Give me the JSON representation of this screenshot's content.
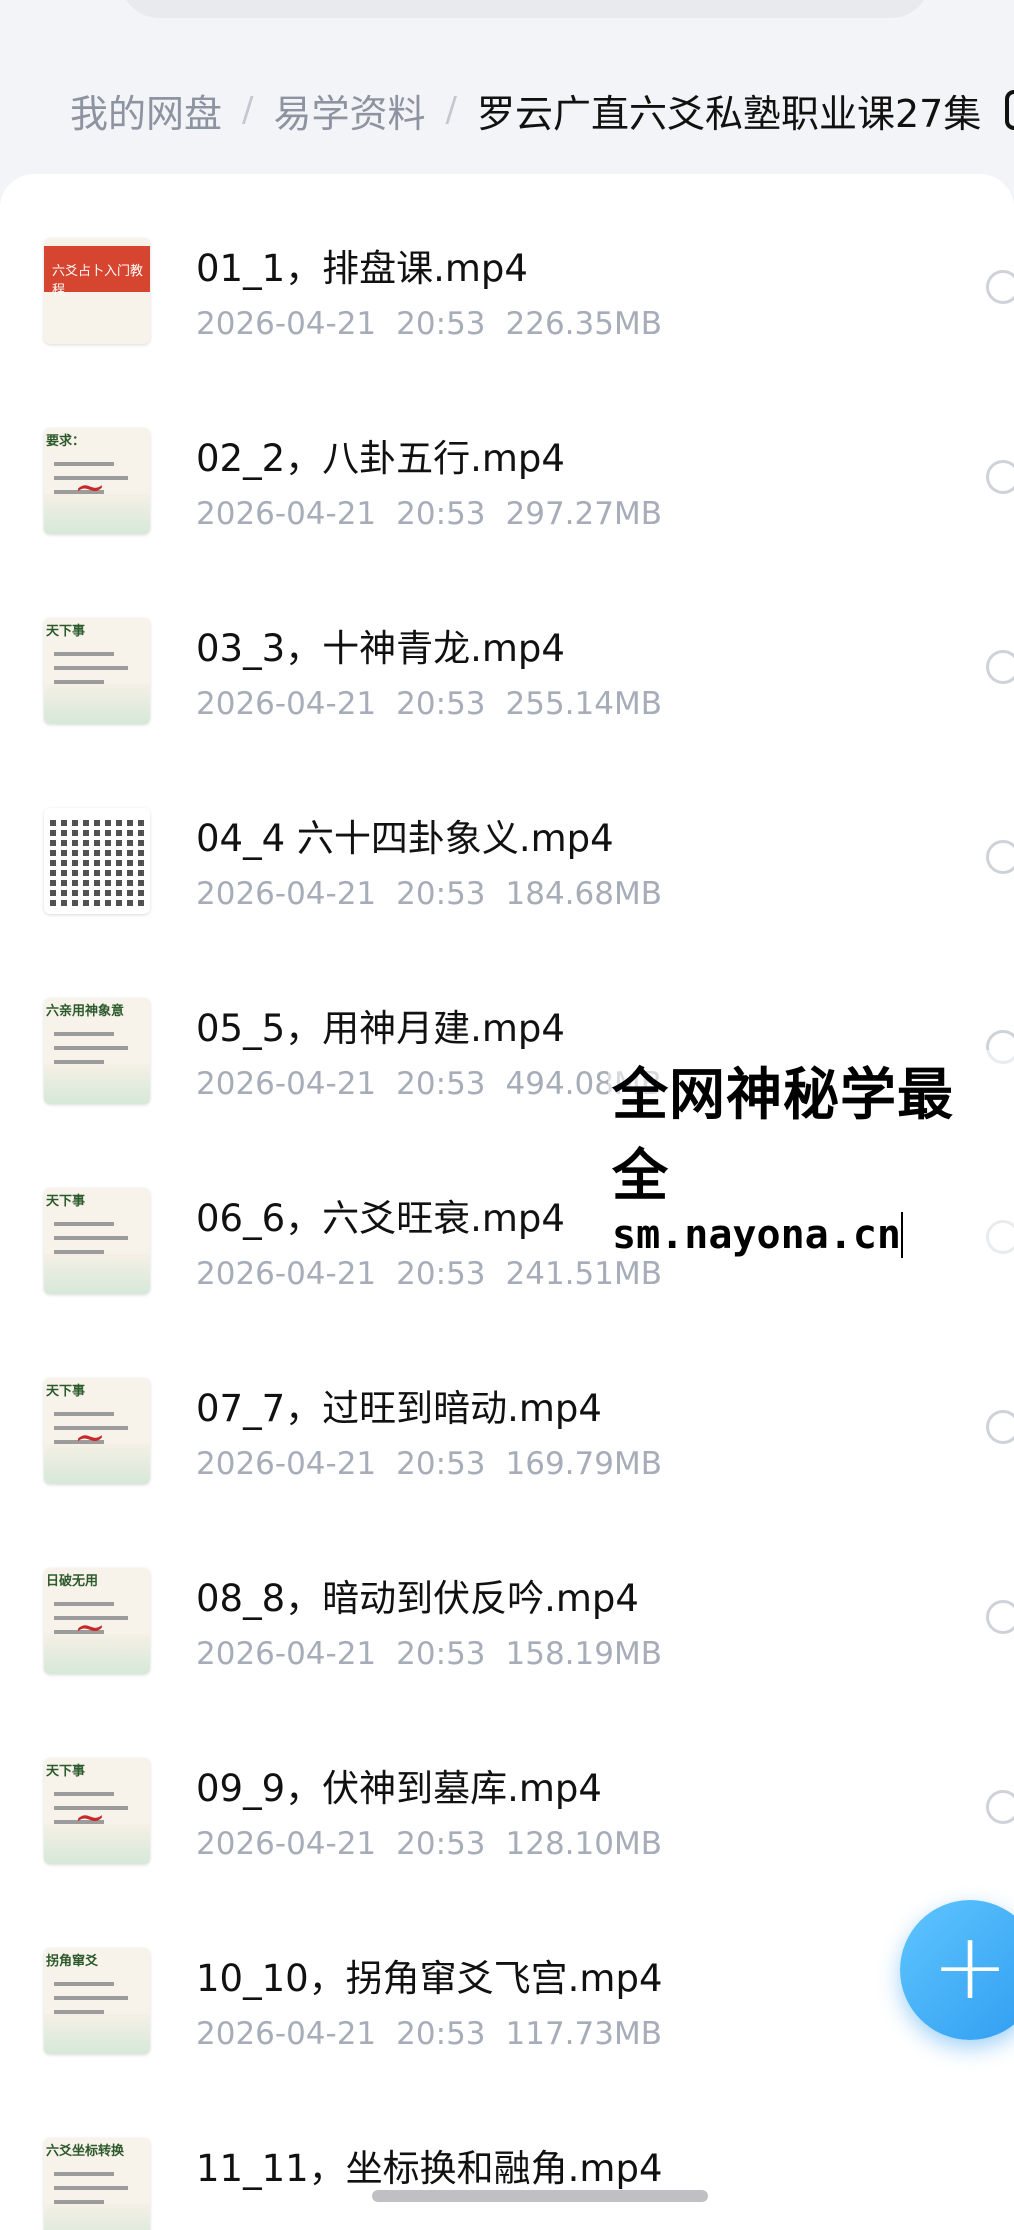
{
  "breadcrumb": {
    "items": [
      "我的网盘",
      "易学资料",
      "罗云广直六爻私塾职业课27集"
    ],
    "separator": "/"
  },
  "files": [
    {
      "name": "01_1，排盘课.mp4",
      "date": "2026-04-21",
      "time": "20:53",
      "size": "226.35MB",
      "thumb": "red-title",
      "thumb_text": "六爻占卜入门教程"
    },
    {
      "name": "02_2，八卦五行.mp4",
      "date": "2026-04-21",
      "time": "20:53",
      "size": "297.27MB",
      "thumb": "handwritten",
      "thumb_text": "要求："
    },
    {
      "name": "03_3，十神青龙.mp4",
      "date": "2026-04-21",
      "time": "20:53",
      "size": "255.14MB",
      "thumb": "slide",
      "thumb_text": "天下事"
    },
    {
      "name": "04_4 六十四卦象义.mp4",
      "date": "2026-04-21",
      "time": "20:53",
      "size": "184.68MB",
      "thumb": "grid",
      "thumb_text": ""
    },
    {
      "name": "05_5，用神月建.mp4",
      "date": "2026-04-21",
      "time": "20:53",
      "size": "494.08MB",
      "thumb": "slide",
      "thumb_text": "六亲用神象意"
    },
    {
      "name": "06_6，六爻旺衰.mp4",
      "date": "2026-04-21",
      "time": "20:53",
      "size": "241.51MB",
      "thumb": "slide",
      "thumb_text": "天下事"
    },
    {
      "name": "07_7，过旺到暗动.mp4",
      "date": "2026-04-21",
      "time": "20:53",
      "size": "169.79MB",
      "thumb": "handwritten",
      "thumb_text": "天下事"
    },
    {
      "name": "08_8，暗动到伏反吟.mp4",
      "date": "2026-04-21",
      "time": "20:53",
      "size": "158.19MB",
      "thumb": "handwritten",
      "thumb_text": "日破无用"
    },
    {
      "name": "09_9，伏神到墓库.mp4",
      "date": "2026-04-21",
      "time": "20:53",
      "size": "128.10MB",
      "thumb": "handwritten",
      "thumb_text": "天下事"
    },
    {
      "name": "10_10，拐角窜爻飞宫.mp4",
      "date": "2026-04-21",
      "time": "20:53",
      "size": "117.73MB",
      "thumb": "slide",
      "thumb_text": "拐角窜爻"
    },
    {
      "name": "11_11，坐标换和融角.mp4",
      "date": "",
      "time": "",
      "size": "",
      "thumb": "slide",
      "thumb_text": "六爻坐标转换"
    }
  ],
  "watermark": {
    "line1": "全网神秘学最全",
    "line2": "sm.nayona.cn"
  },
  "fab": {
    "icon": "plus-icon",
    "symbol": "+"
  },
  "colors": {
    "accent": "#2f9cf0",
    "meta_text": "#a7adb8",
    "breadcrumb_muted": "#8d93a1"
  }
}
